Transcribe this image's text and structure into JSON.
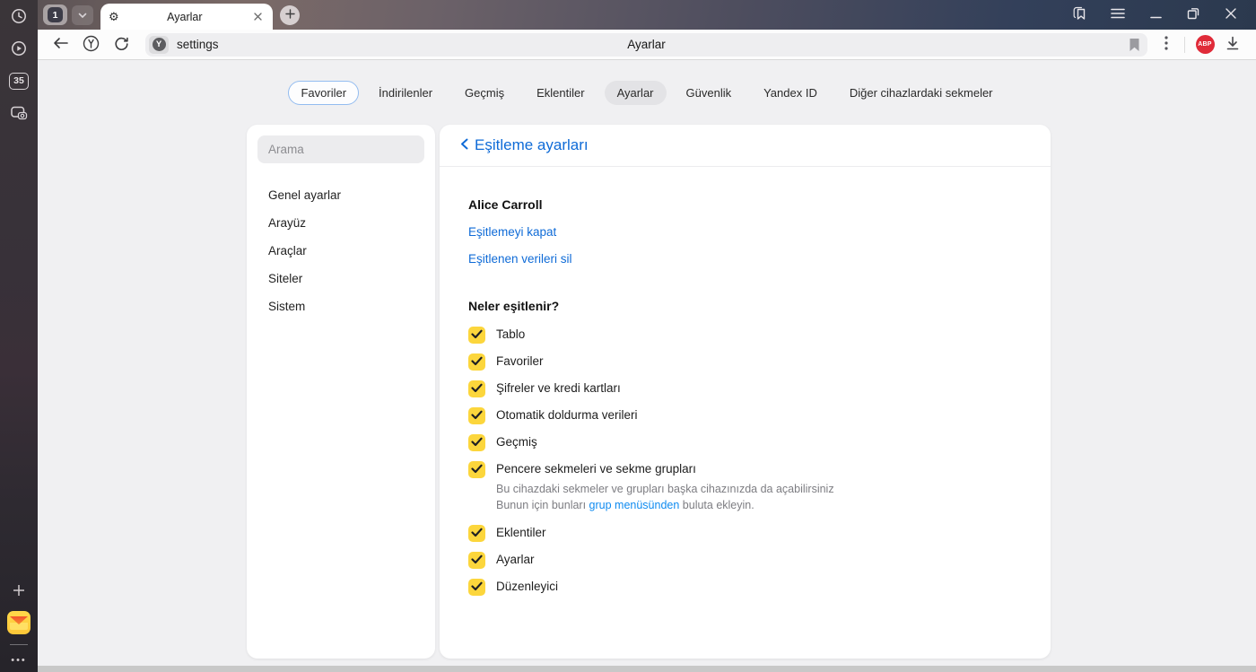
{
  "window": {
    "tab_group_count": "1",
    "tab": {
      "title": "Ayarlar"
    },
    "rail": {
      "tab_counter": "35",
      "more_dots": "•••"
    }
  },
  "toolbar": {
    "url": "settings",
    "page_title": "Ayarlar",
    "site_badge_letter": "Y",
    "extensions": {
      "abp_label": "ABP"
    }
  },
  "nav_tabs": [
    {
      "label": "Favoriler",
      "state": "outlined"
    },
    {
      "label": "İndirilenler",
      "state": ""
    },
    {
      "label": "Geçmiş",
      "state": ""
    },
    {
      "label": "Eklentiler",
      "state": ""
    },
    {
      "label": "Ayarlar",
      "state": "active"
    },
    {
      "label": "Güvenlik",
      "state": ""
    },
    {
      "label": "Yandex ID",
      "state": ""
    },
    {
      "label": "Diğer cihazlardaki sekmeler",
      "state": ""
    }
  ],
  "settings_sidebar": {
    "search_placeholder": "Arama",
    "items": [
      "Genel ayarlar",
      "Arayüz",
      "Araçlar",
      "Siteler",
      "Sistem"
    ]
  },
  "sync_panel": {
    "title": "Eşitleme ayarları",
    "account_name": "Alice Carroll",
    "links": [
      "Eşitlemeyi kapat",
      "Eşitlenen verileri sil"
    ],
    "section_title": "Neler eşitlenir?",
    "checkboxes": [
      {
        "label": "Tablo",
        "checked": true
      },
      {
        "label": "Favoriler",
        "checked": true
      },
      {
        "label": "Şifreler ve kredi kartları",
        "checked": true
      },
      {
        "label": "Otomatik doldurma verileri",
        "checked": true
      },
      {
        "label": "Geçmiş",
        "checked": true
      },
      {
        "label": "Pencere sekmeleri ve sekme grupları",
        "checked": true,
        "description": {
          "line1": "Bu cihazdaki sekmeler ve grupları başka cihazınızda da açabilirsiniz",
          "line2_prefix": "Bunun için bunları ",
          "line2_link": "grup menüsünden",
          "line2_suffix": " buluta ekleyin."
        }
      },
      {
        "label": "Eklentiler",
        "checked": true
      },
      {
        "label": "Ayarlar",
        "checked": true
      },
      {
        "label": "Düzenleyici",
        "checked": true
      }
    ]
  },
  "colors": {
    "accent_blue": "#0f6bd7",
    "checkbox_yellow": "#fcd63c",
    "abp_red": "#e02b39",
    "titlebar_right": "#2b394e",
    "page_bg": "#f0f0f2"
  }
}
